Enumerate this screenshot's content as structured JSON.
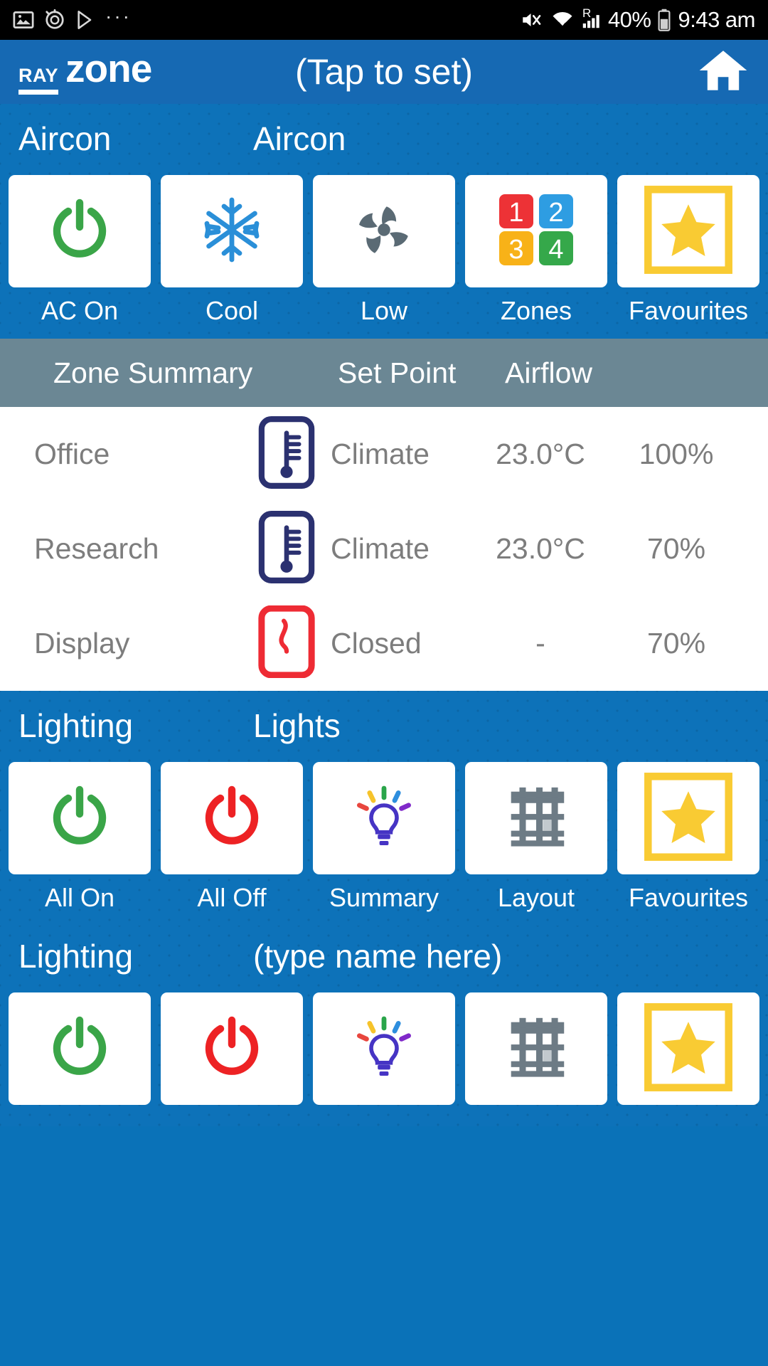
{
  "status_bar": {
    "left_icons": [
      "image-icon",
      "alarm-icon",
      "play-store-icon",
      "more-dots-icon"
    ],
    "more_dots": "···",
    "right_icons": [
      "mute-icon",
      "wifi-icon",
      "roaming-signal-icon",
      "battery-icon"
    ],
    "roaming_letter": "R",
    "battery_percent": "40%",
    "time": "9:43 am"
  },
  "header": {
    "logo_primary": "RAY",
    "logo_secondary": "zone",
    "title": "(Tap to set)",
    "home_icon": "home-icon"
  },
  "aircon": {
    "group_label": "Aircon",
    "name_label": "Aircon",
    "tiles": [
      {
        "label": "AC On",
        "icon": "power-on-icon"
      },
      {
        "label": "Cool",
        "icon": "snowflake-icon"
      },
      {
        "label": "Low",
        "icon": "fan-icon"
      },
      {
        "label": "Zones",
        "icon": "zones-grid-icon"
      },
      {
        "label": "Favourites",
        "icon": "star-icon"
      }
    ],
    "zone_numbers": [
      "1",
      "2",
      "3",
      "4"
    ]
  },
  "zone_table": {
    "headers": {
      "zone_summary": "Zone Summary",
      "set_point": "Set Point",
      "airflow": "Airflow"
    },
    "rows": [
      {
        "name": "Office",
        "icon": "thermometer-icon",
        "state": "Climate",
        "set_point": "23.0°C",
        "airflow": "100%"
      },
      {
        "name": "Research",
        "icon": "thermometer-icon",
        "state": "Climate",
        "set_point": "23.0°C",
        "airflow": "70%"
      },
      {
        "name": "Display",
        "icon": "damper-closed-icon",
        "state": "Closed",
        "set_point": "-",
        "airflow": "70%"
      }
    ]
  },
  "lighting_lights": {
    "group_label": "Lighting",
    "name_label": "Lights",
    "tiles": [
      {
        "label": "All On",
        "icon": "power-on-icon"
      },
      {
        "label": "All Off",
        "icon": "power-off-icon"
      },
      {
        "label": "Summary",
        "icon": "lightbulb-icon"
      },
      {
        "label": "Layout",
        "icon": "grid-layout-icon"
      },
      {
        "label": "Favourites",
        "icon": "star-icon"
      }
    ]
  },
  "lighting_unnamed": {
    "group_label": "Lighting",
    "name_label": "(type name here)",
    "tiles": [
      {
        "label": "",
        "icon": "power-on-icon"
      },
      {
        "label": "",
        "icon": "power-off-icon"
      },
      {
        "label": "",
        "icon": "lightbulb-icon"
      },
      {
        "label": "",
        "icon": "grid-layout-icon"
      },
      {
        "label": "",
        "icon": "star-icon"
      }
    ]
  },
  "colors": {
    "header_blue": "#1669b3",
    "panel_blue": "#0d72b9",
    "table_header_gray": "#6b8794",
    "power_on_green": "#3aa548",
    "power_off_red": "#ed2224",
    "snowflake_blue": "#2a8fd8",
    "fan_gray": "#5a6a74",
    "star_yellow": "#f9cb33",
    "thermo_navy": "#2b3170",
    "closed_red": "#ee2b34",
    "text_gray": "#7d7d7d"
  }
}
